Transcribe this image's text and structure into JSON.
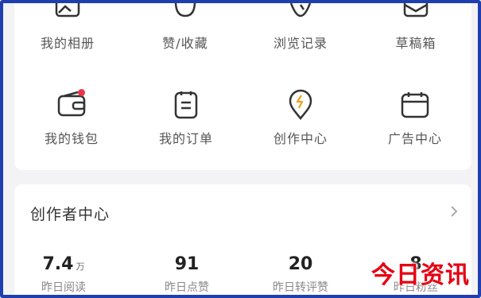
{
  "grid_row1": [
    {
      "label": "我的相册",
      "icon": "photo-album-icon"
    },
    {
      "label": "赞/收藏",
      "icon": "like-collect-icon"
    },
    {
      "label": "浏览记录",
      "icon": "history-icon"
    },
    {
      "label": "草稿箱",
      "icon": "drafts-icon"
    }
  ],
  "grid_row2": [
    {
      "label": "我的钱包",
      "icon": "wallet-icon",
      "badge_color": "#e5364a"
    },
    {
      "label": "我的订单",
      "icon": "orders-icon"
    },
    {
      "label": "创作中心",
      "icon": "creation-center-icon"
    },
    {
      "label": "广告中心",
      "icon": "ad-center-icon"
    }
  ],
  "creator_center": {
    "title": "创作者中心",
    "stats": [
      {
        "value": "7.4",
        "unit": "万",
        "label": "昨日阅读"
      },
      {
        "value": "91",
        "unit": "",
        "label": "昨日点赞"
      },
      {
        "value": "20",
        "unit": "",
        "label": "昨日转评赞"
      },
      {
        "value": "8",
        "unit": "",
        "label": "昨日粉丝"
      }
    ]
  },
  "watermark": "今日资讯",
  "colors": {
    "frame_border": "#1f3fae",
    "accent_red": "#e60012",
    "badge_red": "#e5364a"
  }
}
